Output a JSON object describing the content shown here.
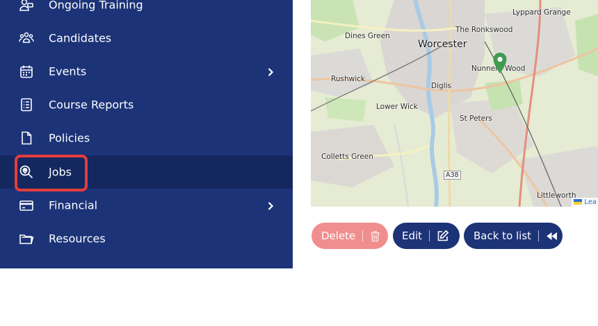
{
  "sidebar": {
    "items": [
      {
        "label": "Ongoing Training",
        "icon": "trainee-icon"
      },
      {
        "label": "Candidates",
        "icon": "people-icon"
      },
      {
        "label": "Events",
        "icon": "calendar-icon",
        "has_submenu": true
      },
      {
        "label": "Course Reports",
        "icon": "report-icon"
      },
      {
        "label": "Policies",
        "icon": "document-icon"
      },
      {
        "label": "Jobs",
        "icon": "location-search-icon",
        "active": true
      },
      {
        "label": "Financial",
        "icon": "card-icon",
        "has_submenu": true
      },
      {
        "label": "Resources",
        "icon": "folder-icon"
      }
    ]
  },
  "map": {
    "labels": [
      "Lyppard Grange",
      "Dines Green",
      "The Ronkswood",
      "Worcester",
      "Nunnery Wood",
      "Rushwick",
      "Diglis",
      "Lower Wick",
      "St Peters",
      "Colletts Green",
      "A38",
      "Littleworth"
    ],
    "attribution": "Lea",
    "marker_color": "#3f9a52"
  },
  "actions": {
    "delete_label": "Delete",
    "edit_label": "Edit",
    "back_label": "Back to list"
  },
  "colors": {
    "sidebar_bg": "#1c3378",
    "active_bg": "#14285f",
    "highlight": "#e53d3d",
    "delete_bg": "#f08e8e",
    "primary": "#1c3378"
  }
}
